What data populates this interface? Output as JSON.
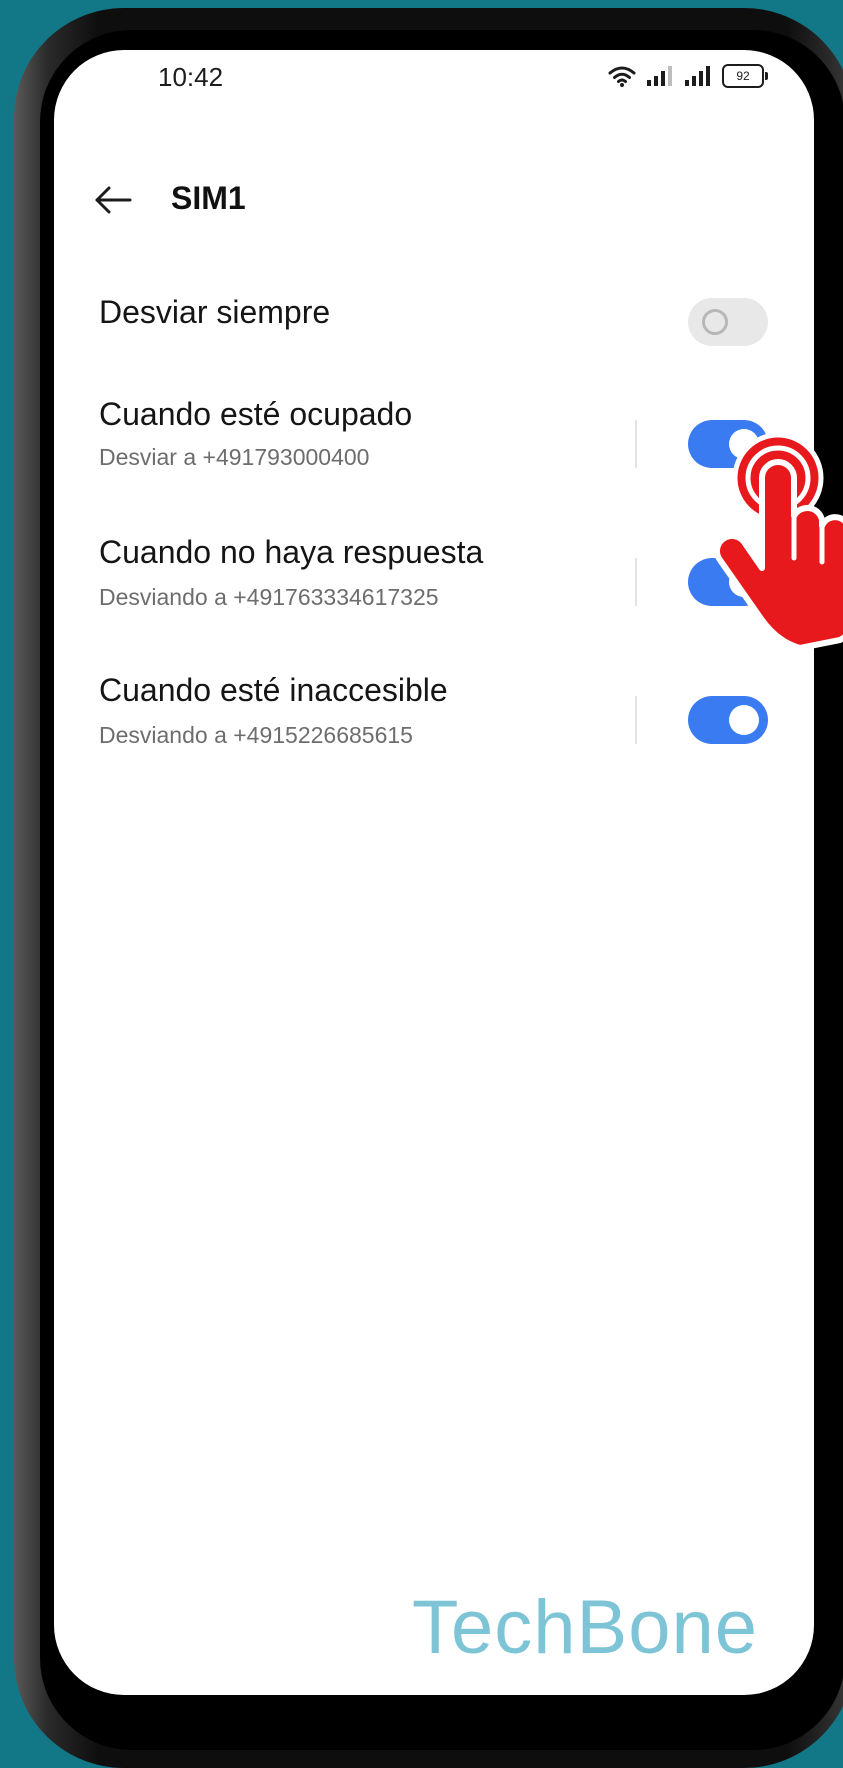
{
  "status_bar": {
    "time": "10:42",
    "battery": "92",
    "icons": [
      "wifi-icon",
      "signal-icon",
      "signal-icon",
      "battery-icon"
    ]
  },
  "header": {
    "back_icon": "arrow-left-icon",
    "title": "SIM1"
  },
  "settings": [
    {
      "title": "Desviar siempre",
      "subtitle": "",
      "enabled": false
    },
    {
      "title": "Cuando esté ocupado",
      "subtitle": "Desviar a +491793000400",
      "enabled": true
    },
    {
      "title": "Cuando no haya respuesta",
      "subtitle": "Desviando a +491763334617325",
      "enabled": true
    },
    {
      "title": "Cuando esté inaccesible",
      "subtitle": "Desviando a +4915226685615",
      "enabled": true
    }
  ],
  "colors": {
    "accent": "#3a7bf2",
    "background": "#127888",
    "pointer": "#e8191c",
    "watermark": "#7dc4d6"
  },
  "overlay": {
    "pointer_icon": "hand-pointer-icon",
    "watermark": "TechBone"
  }
}
